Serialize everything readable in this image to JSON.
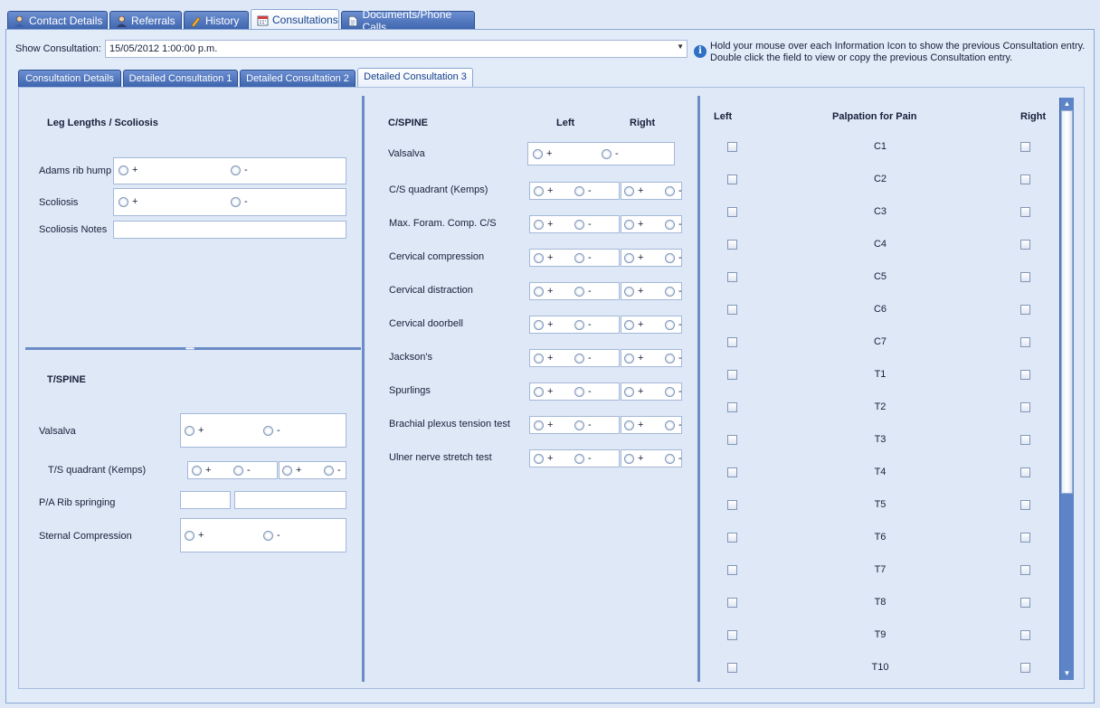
{
  "top_tabs": [
    {
      "label": "Contact Details",
      "icon": "contact-icon"
    },
    {
      "label": "Referrals",
      "icon": "referrals-icon"
    },
    {
      "label": "History",
      "icon": "history-icon"
    },
    {
      "label": "Consultations",
      "icon": "calendar-icon"
    },
    {
      "label": "Documents/Phone Calls",
      "icon": "document-icon"
    }
  ],
  "active_top_tab": "Consultations",
  "show_consultation": {
    "label": "Show Consultation:",
    "value": "15/05/2012 1:00:00 p.m."
  },
  "info": {
    "line1": "Hold your mouse over each Information Icon to show the previous Consultation entry.",
    "line2": "Double click the field to view or copy the previous Consultation entry."
  },
  "sub_tabs": [
    "Consultation Details",
    "Detailed Consultation 1",
    "Detailed Consultation 2",
    "Detailed Consultation 3"
  ],
  "active_sub_tab": "Detailed Consultation 3",
  "plus": "+",
  "minus": "-",
  "leg": {
    "title": "Leg Lengths / Scoliosis",
    "adams": "Adams rib hump",
    "scoliosis": "Scoliosis",
    "notes": "Scoliosis Notes"
  },
  "tspine": {
    "title": "T/SPINE",
    "valsalva": "Valsalva",
    "quadrant": "T/S quadrant (Kemps)",
    "rib": "P/A Rib springing",
    "sternal": "Sternal Compression"
  },
  "cspine": {
    "title": "C/SPINE",
    "left": "Left",
    "right": "Right",
    "valsalva": "Valsalva",
    "tests": [
      "C/S quadrant (Kemps)",
      "Max. Foram. Comp. C/S",
      "Cervical compression",
      "Cervical distraction",
      "Cervical doorbell",
      "Jackson's",
      "Spurlings",
      "Brachial plexus tension test",
      "Ulner nerve stretch test"
    ]
  },
  "palpation": {
    "left": "Left",
    "title": "Palpation for Pain",
    "right": "Right",
    "levels": [
      "C1",
      "C2",
      "C3",
      "C4",
      "C5",
      "C6",
      "C7",
      "T1",
      "T2",
      "T3",
      "T4",
      "T5",
      "T6",
      "T7",
      "T8",
      "T9",
      "T10"
    ]
  }
}
